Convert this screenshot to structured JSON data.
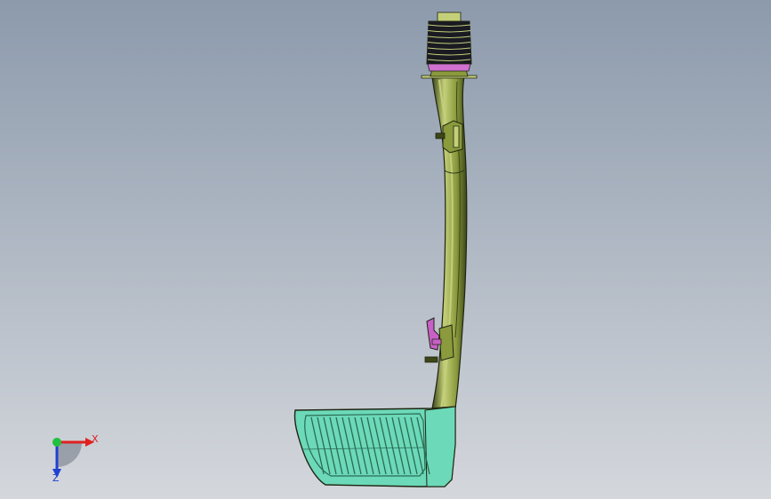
{
  "viewport": {
    "background_top": "#8c9aac",
    "background_bottom": "#d4d7dc"
  },
  "model": {
    "tube_color": "#8a9a3c",
    "tube_light": "#c4cf7a",
    "tube_dark": "#3c4618",
    "bellows_color": "#1a1a22",
    "clamp_color": "#d070d0",
    "box_color": "#6cd9b8",
    "box_dark": "#2a6b55",
    "bracket_color": "#c860c8",
    "edge_color": "#1e2410"
  },
  "triad": {
    "x_label": "X",
    "z_label": "Z",
    "x_color": "#e02020",
    "y_color": "#20c040",
    "z_color": "#2040d0"
  }
}
